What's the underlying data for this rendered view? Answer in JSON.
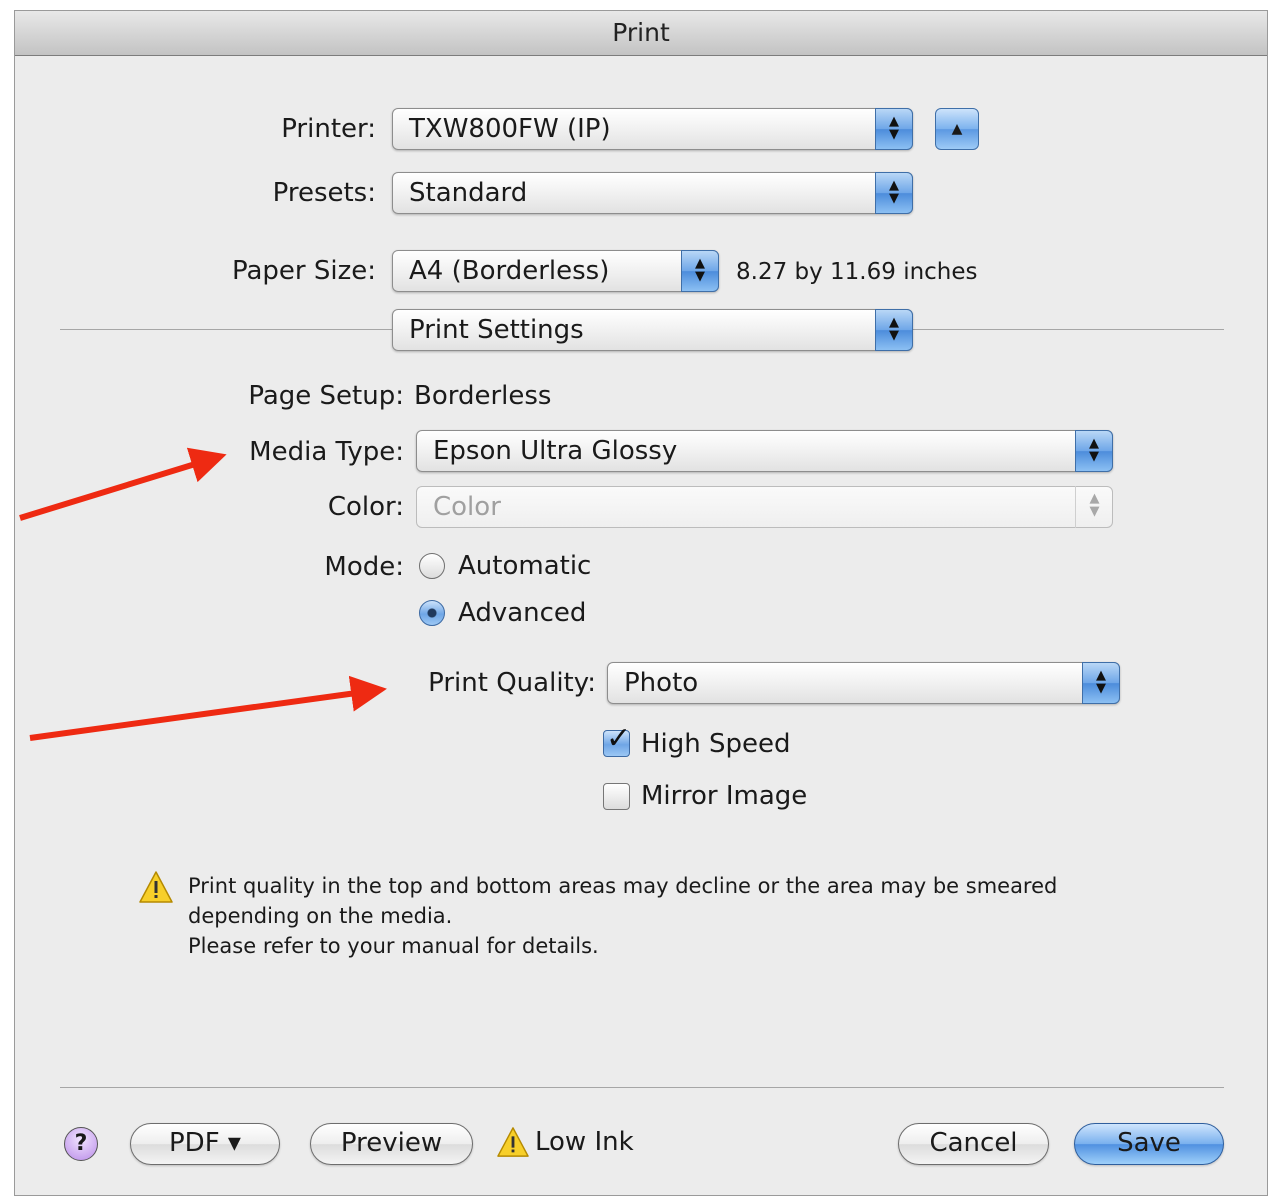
{
  "window": {
    "title": "Print"
  },
  "printer": {
    "label": "Printer:",
    "value": "TXW800FW (IP)"
  },
  "presets": {
    "label": "Presets:",
    "value": "Standard"
  },
  "paper_size": {
    "label": "Paper Size:",
    "value": "A4 (Borderless)",
    "dimensions": "8.27 by 11.69 inches"
  },
  "panel": {
    "value": "Print Settings"
  },
  "page_setup": {
    "label": "Page Setup:",
    "value": "Borderless"
  },
  "media_type": {
    "label": "Media Type:",
    "value": "Epson Ultra Glossy"
  },
  "color": {
    "label": "Color:",
    "value": "Color"
  },
  "mode": {
    "label": "Mode:",
    "options": [
      "Automatic",
      "Advanced"
    ],
    "selected": "Advanced"
  },
  "print_quality": {
    "label": "Print Quality:",
    "value": "Photo"
  },
  "options": {
    "high_speed": "High Speed",
    "high_speed_checked": true,
    "mirror_image": "Mirror Image",
    "mirror_image_checked": false
  },
  "notice": {
    "line1": "Print quality in the top and bottom areas may decline or the area may be smeared",
    "line2": "depending on the media.",
    "line3": "Please refer to your manual for details."
  },
  "bottom": {
    "help": "?",
    "pdf": "PDF ▾",
    "preview": "Preview",
    "low_ink": "Low Ink",
    "cancel": "Cancel",
    "save": "Save"
  },
  "colors": {
    "annotation_arrow": "#ee2a12",
    "accent": "#5a98e4"
  }
}
